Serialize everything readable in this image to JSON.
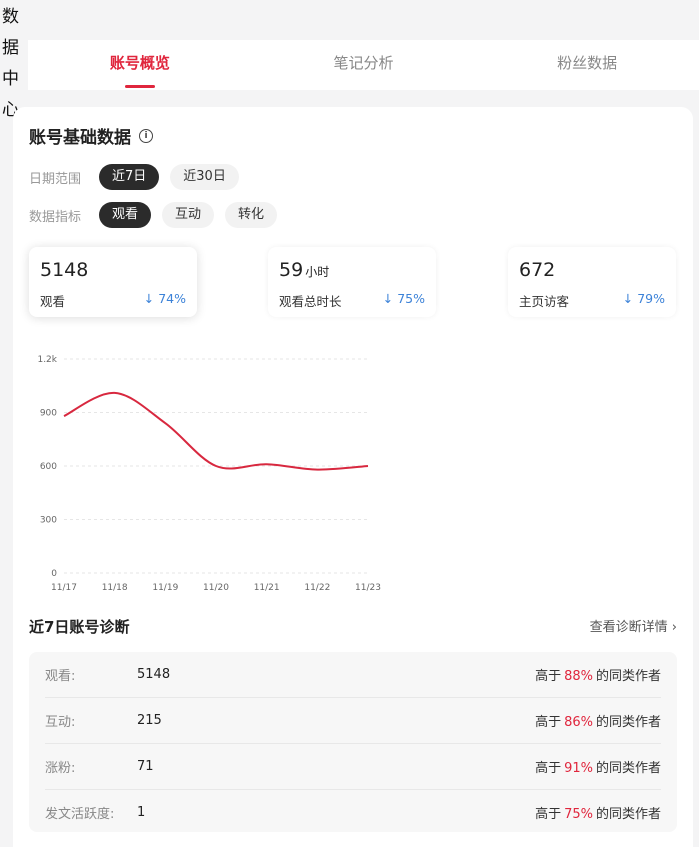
{
  "page": {
    "title_chars": [
      "数",
      "据",
      "中",
      "心"
    ]
  },
  "tabs": [
    {
      "label": "账号概览",
      "active": true
    },
    {
      "label": "笔记分析",
      "active": false
    },
    {
      "label": "粉丝数据",
      "active": false
    }
  ],
  "card": {
    "title": "账号基础数据",
    "date_range": {
      "label": "日期范围",
      "options": [
        "近7日",
        "近30日"
      ],
      "selected": "近7日"
    },
    "metric_type": {
      "label": "数据指标",
      "options": [
        "观看",
        "互动",
        "转化"
      ],
      "selected": "观看"
    }
  },
  "metrics": [
    {
      "value": "5148",
      "unit": "",
      "label": "观看",
      "change": "↓ 74%",
      "selected": true
    },
    {
      "value": "59",
      "unit": "小时",
      "label": "观看总时长",
      "change": "↓ 75%",
      "selected": false
    },
    {
      "value": "672",
      "unit": "",
      "label": "主页访客",
      "change": "↓ 79%",
      "selected": false
    }
  ],
  "chart_data": {
    "type": "line",
    "x": [
      "11/17",
      "11/18",
      "11/19",
      "11/20",
      "11/21",
      "11/22",
      "11/23"
    ],
    "series": [
      {
        "values": [
          880,
          1010,
          840,
          600,
          610,
          580,
          600
        ]
      }
    ],
    "y_ticks": [
      "0",
      "300",
      "600",
      "900",
      "1.2k"
    ],
    "ylim": [
      0,
      1200
    ],
    "grid": true,
    "line_color": "#d8283f"
  },
  "diagnosis": {
    "title": "近7日账号诊断",
    "link": "查看诊断详情 ›",
    "rank_prefix": "高于",
    "rank_suffix": "的同类作者",
    "rows": [
      {
        "label": "观看:",
        "value": "5148",
        "pct": "88%"
      },
      {
        "label": "互动:",
        "value": "215",
        "pct": "86%"
      },
      {
        "label": "涨粉:",
        "value": "71",
        "pct": "91%"
      },
      {
        "label": "发文活跃度:",
        "value": "1",
        "pct": "75%"
      }
    ]
  },
  "colors": {
    "accent": "#e0263d",
    "change_blue": "#3c82d8",
    "chip_active": "#2b2b2b"
  }
}
